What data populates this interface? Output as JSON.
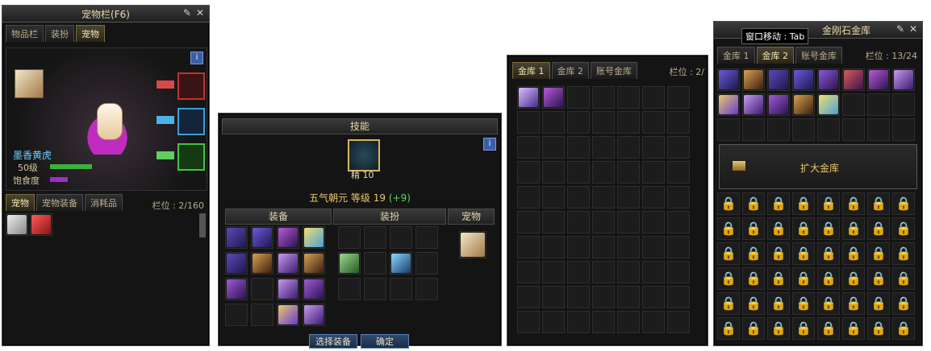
{
  "pet_window": {
    "title": "宠物栏(F6)",
    "tabs": [
      "物品栏",
      "装扮",
      "宠物"
    ],
    "active_tab": 2,
    "pet_name": "墨香黄虎",
    "level_label": "50级",
    "satiety_label": "饱食度",
    "info_label": "i",
    "subtabs": [
      "宠物",
      "宠物装备",
      "消耗品"
    ],
    "slot_label": "栏位 : 2/160"
  },
  "skill_window": {
    "skill_header": "技能",
    "skill_level_badge": "精 10",
    "skill_name": "五气朝元",
    "skill_level_text": "等级 19",
    "skill_bonus": "(+9)",
    "info_label": "i",
    "sections": [
      "装备",
      "装扮",
      "宠物"
    ],
    "buttons": {
      "select_equip": "选择装备",
      "confirm": "确定"
    }
  },
  "vault_window": {
    "tabs": [
      "金库 1",
      "金库 2",
      "账号金库"
    ],
    "slot_label": "栏位 : 2/"
  },
  "gold_vault_window": {
    "tooltip": "窗口移动 : Tab",
    "title": "金刚石金库",
    "tabs": [
      "金库 1",
      "金库 2",
      "账号金库"
    ],
    "slot_label": "栏位 : 13/24",
    "expand_button": "扩大金库"
  },
  "colors": {
    "accent": "#e8c86a",
    "panel_bg": "#141414",
    "green_text": "#5fd35f"
  }
}
